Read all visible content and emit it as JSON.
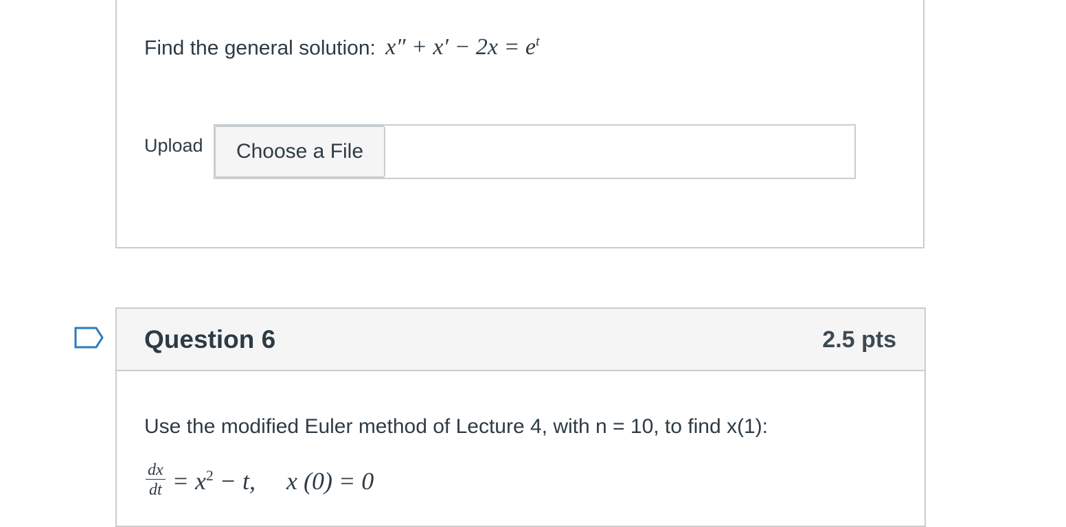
{
  "question5": {
    "prompt": "Find the general solution:",
    "equation": "x″ + x′ − 2x = e",
    "equation_exp": "t",
    "upload_label": "Upload",
    "choose_file_label": "Choose a File"
  },
  "question6": {
    "title": "Question 6",
    "points": "2.5 pts",
    "prompt": "Use the modified Euler method of Lecture 4, with n = 10,  to find x(1):",
    "frac_num": "dx",
    "frac_den": "dt",
    "eq_rhs_pre": "= x",
    "eq_rhs_exp": "2",
    "eq_rhs_post": " − t,     x (0) = 0"
  },
  "icons": {
    "flag": "flag-outline-icon"
  },
  "colors": {
    "border": "#c7cdd1",
    "text": "#2d3b45",
    "header_bg": "#f5f5f5"
  }
}
